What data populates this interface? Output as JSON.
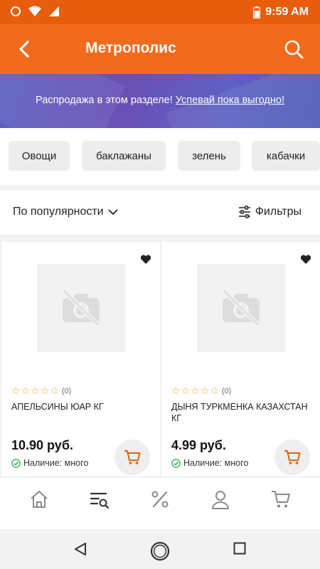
{
  "status_bar": {
    "time": "9:59 AM"
  },
  "header": {
    "title": "Метрополис"
  },
  "banner": {
    "text": "Распродажа в этом разделе! ",
    "link": "Успевай пока выгодно!"
  },
  "categories": [
    "Овощи",
    "баклажаны",
    "зелень",
    "кабачки"
  ],
  "sort": {
    "label": "По популярности"
  },
  "filters": {
    "label": "Фильтры"
  },
  "products": [
    {
      "name": "АПЕЛЬСИНЫ ЮАР КГ",
      "price": "10.90 руб.",
      "rating_count": "(0)",
      "stock": "Наличие: много"
    },
    {
      "name": "ДЫНЯ ТУРКМЕНКА КАЗАХСТАН КГ",
      "price": "4.99 руб.",
      "rating_count": "(0)",
      "stock": "Наличие: много"
    }
  ],
  "colors": {
    "brand": "#f26b1d",
    "status_bar": "#e85d0c",
    "star": "#e8a92b",
    "stock_ok": "#2aa84a"
  },
  "bottom_nav": [
    "home-icon",
    "catalog-search-icon",
    "percent-icon",
    "profile-icon",
    "cart-icon"
  ]
}
